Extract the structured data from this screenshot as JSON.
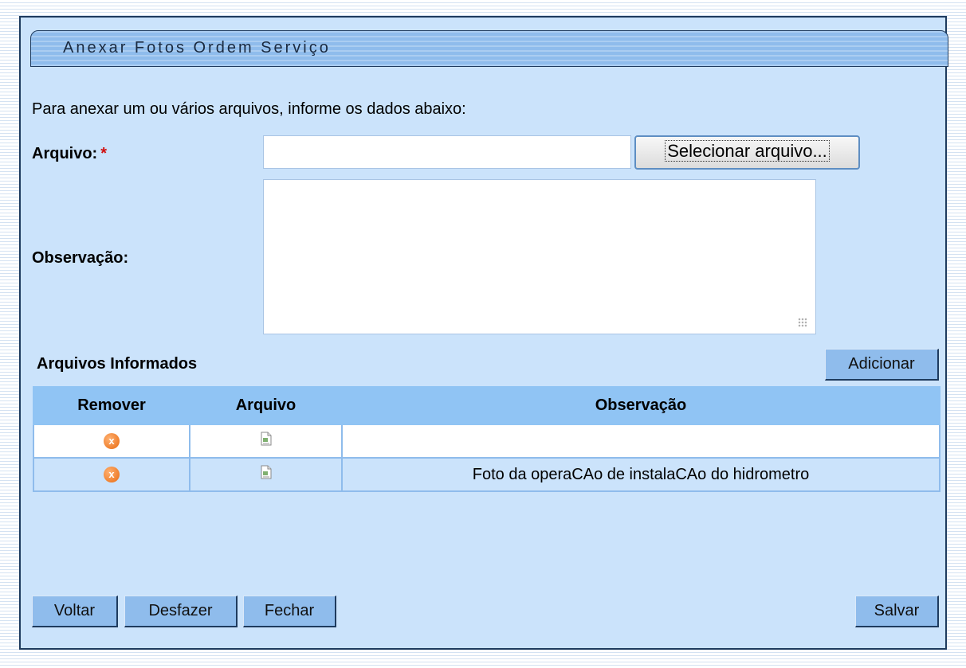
{
  "window": {
    "title": "Anexar Fotos Ordem Serviço"
  },
  "form": {
    "instructions": "Para anexar um ou vários arquivos, informe os dados abaixo:",
    "arquivo_label": "Arquivo:",
    "required_mark": "*",
    "arquivo_value": "",
    "browse_label": "Selecionar arquivo...",
    "observacao_label": "Observação:",
    "observacao_value": ""
  },
  "files": {
    "heading": "Arquivos Informados",
    "add_label": "Adicionar",
    "columns": [
      "Remover",
      "Arquivo",
      "Observação"
    ],
    "rows": [
      {
        "remove_icon": "remove-icon",
        "file_icon": "document-icon",
        "observacao": ""
      },
      {
        "remove_icon": "remove-icon",
        "file_icon": "document-icon",
        "observacao": "Foto da operaCAo de instalaCAo do hidrometro"
      }
    ]
  },
  "footer": {
    "voltar": "Voltar",
    "desfazer": "Desfazer",
    "fechar": "Fechar",
    "salvar": "Salvar"
  },
  "colors": {
    "panel_bg": "#cbe3fb",
    "button_bg": "#8fbcec",
    "table_header_bg": "#90c4f4",
    "required": "#d01010",
    "remove_icon": "#e86a10"
  }
}
